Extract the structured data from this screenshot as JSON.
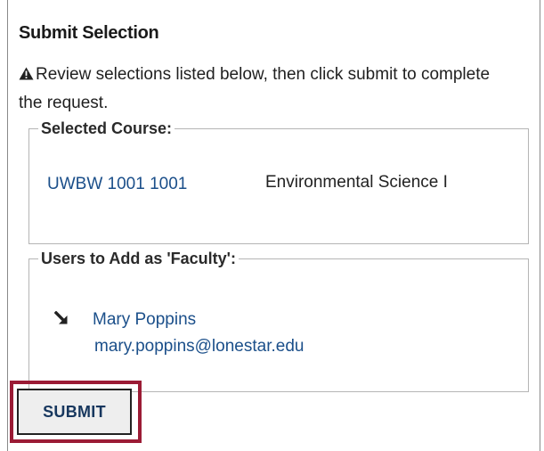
{
  "heading": "Submit Selection",
  "notice": {
    "icon": "warning-triangle-icon",
    "text": "Review selections listed below, then click submit to complete the request."
  },
  "selected_course": {
    "legend": "Selected Course:",
    "code": "UWBW 1001 1001",
    "title": "Environmental Science I"
  },
  "users": {
    "legend": "Users to Add as 'Faculty':",
    "items": [
      {
        "icon": "arrow-down-right-icon",
        "name": "Mary Poppins",
        "email": "mary.poppins@lonestar.edu"
      }
    ]
  },
  "submit": {
    "label": "SUBMIT"
  },
  "colors": {
    "link": "#1b4f8a",
    "highlight": "#9b1b35",
    "button_text": "#17375e"
  }
}
